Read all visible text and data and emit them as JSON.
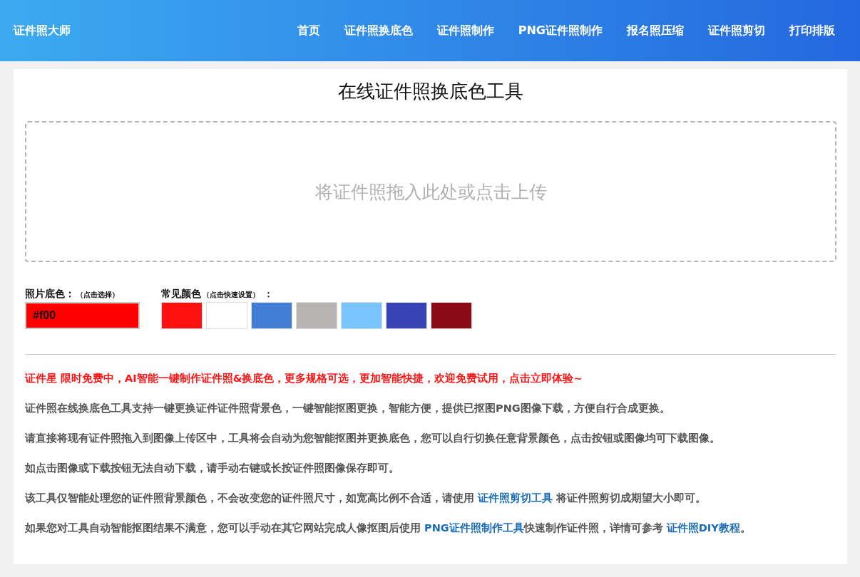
{
  "header": {
    "logo": "证件照大师",
    "nav": [
      {
        "label": "首页"
      },
      {
        "label": "证件照换底色"
      },
      {
        "label": "证件照制作"
      },
      {
        "label": "PNG证件照制作"
      },
      {
        "label": "报名照压缩"
      },
      {
        "label": "证件照剪切"
      },
      {
        "label": "打印排版"
      }
    ]
  },
  "title": "在线证件照换底色工具",
  "upload": {
    "prompt": "将证件照拖入此处或点击上传"
  },
  "bg_color": {
    "label": "照片底色：",
    "hint": "（点击选择）",
    "value": "#f00"
  },
  "presets": {
    "label": "常见颜色",
    "hint": "（点击快速设置）",
    "suffix": "：",
    "swatches": [
      {
        "color": "#ff1111"
      },
      {
        "color": "#ffffff"
      },
      {
        "color": "#417ed4"
      },
      {
        "color": "#b7b3b3"
      },
      {
        "color": "#77c4ff"
      },
      {
        "color": "#3a43b5"
      },
      {
        "color": "#8a0a18"
      }
    ]
  },
  "paragraphs": [
    {
      "kind": "promo",
      "parts": [
        {
          "kind": "text",
          "text": "证件星 限时免费中，AI智能一键制作证件照&换底色，更多规格可选，更加智能快捷，欢迎免费试用，点击立即体验~"
        }
      ]
    },
    {
      "kind": "info",
      "parts": [
        {
          "kind": "text",
          "text": "证件照在线换底色工具支持一键更换证件证件照背景色，一键智能抠图更换，智能方便，提供已抠图PNG图像下载，方便自行合成更换。"
        }
      ]
    },
    {
      "kind": "info",
      "parts": [
        {
          "kind": "text",
          "text": "请直接将现有证件照拖入到图像上传区中，工具将会自动为您智能抠图并更换底色，您可以自行切换任意背景颜色，点击按钮或图像均可下载图像。"
        }
      ]
    },
    {
      "kind": "info",
      "parts": [
        {
          "kind": "text",
          "text": "如点击图像或下载按钮无法自动下载，请手动右键或长按证件照图像保存即可。"
        }
      ]
    },
    {
      "kind": "info",
      "parts": [
        {
          "kind": "text",
          "text": "该工具仅智能处理您的证件照背景颜色，不会改变您的证件照尺寸，如宽高比例不合适，请使用 "
        },
        {
          "kind": "link",
          "text": "证件照剪切工具"
        },
        {
          "kind": "text",
          "text": " 将证件照剪切成期望大小即可。"
        }
      ]
    },
    {
      "kind": "info",
      "parts": [
        {
          "kind": "text",
          "text": "如果您对工具自动智能抠图结果不满意，您可以手动在其它网站完成人像抠图后使用 "
        },
        {
          "kind": "link",
          "text": "PNG证件照制作工具"
        },
        {
          "kind": "text",
          "text": "快速制作证件照，详情可参考 "
        },
        {
          "kind": "link",
          "text": "证件照DIY教程"
        },
        {
          "kind": "text",
          "text": "。"
        }
      ]
    }
  ]
}
